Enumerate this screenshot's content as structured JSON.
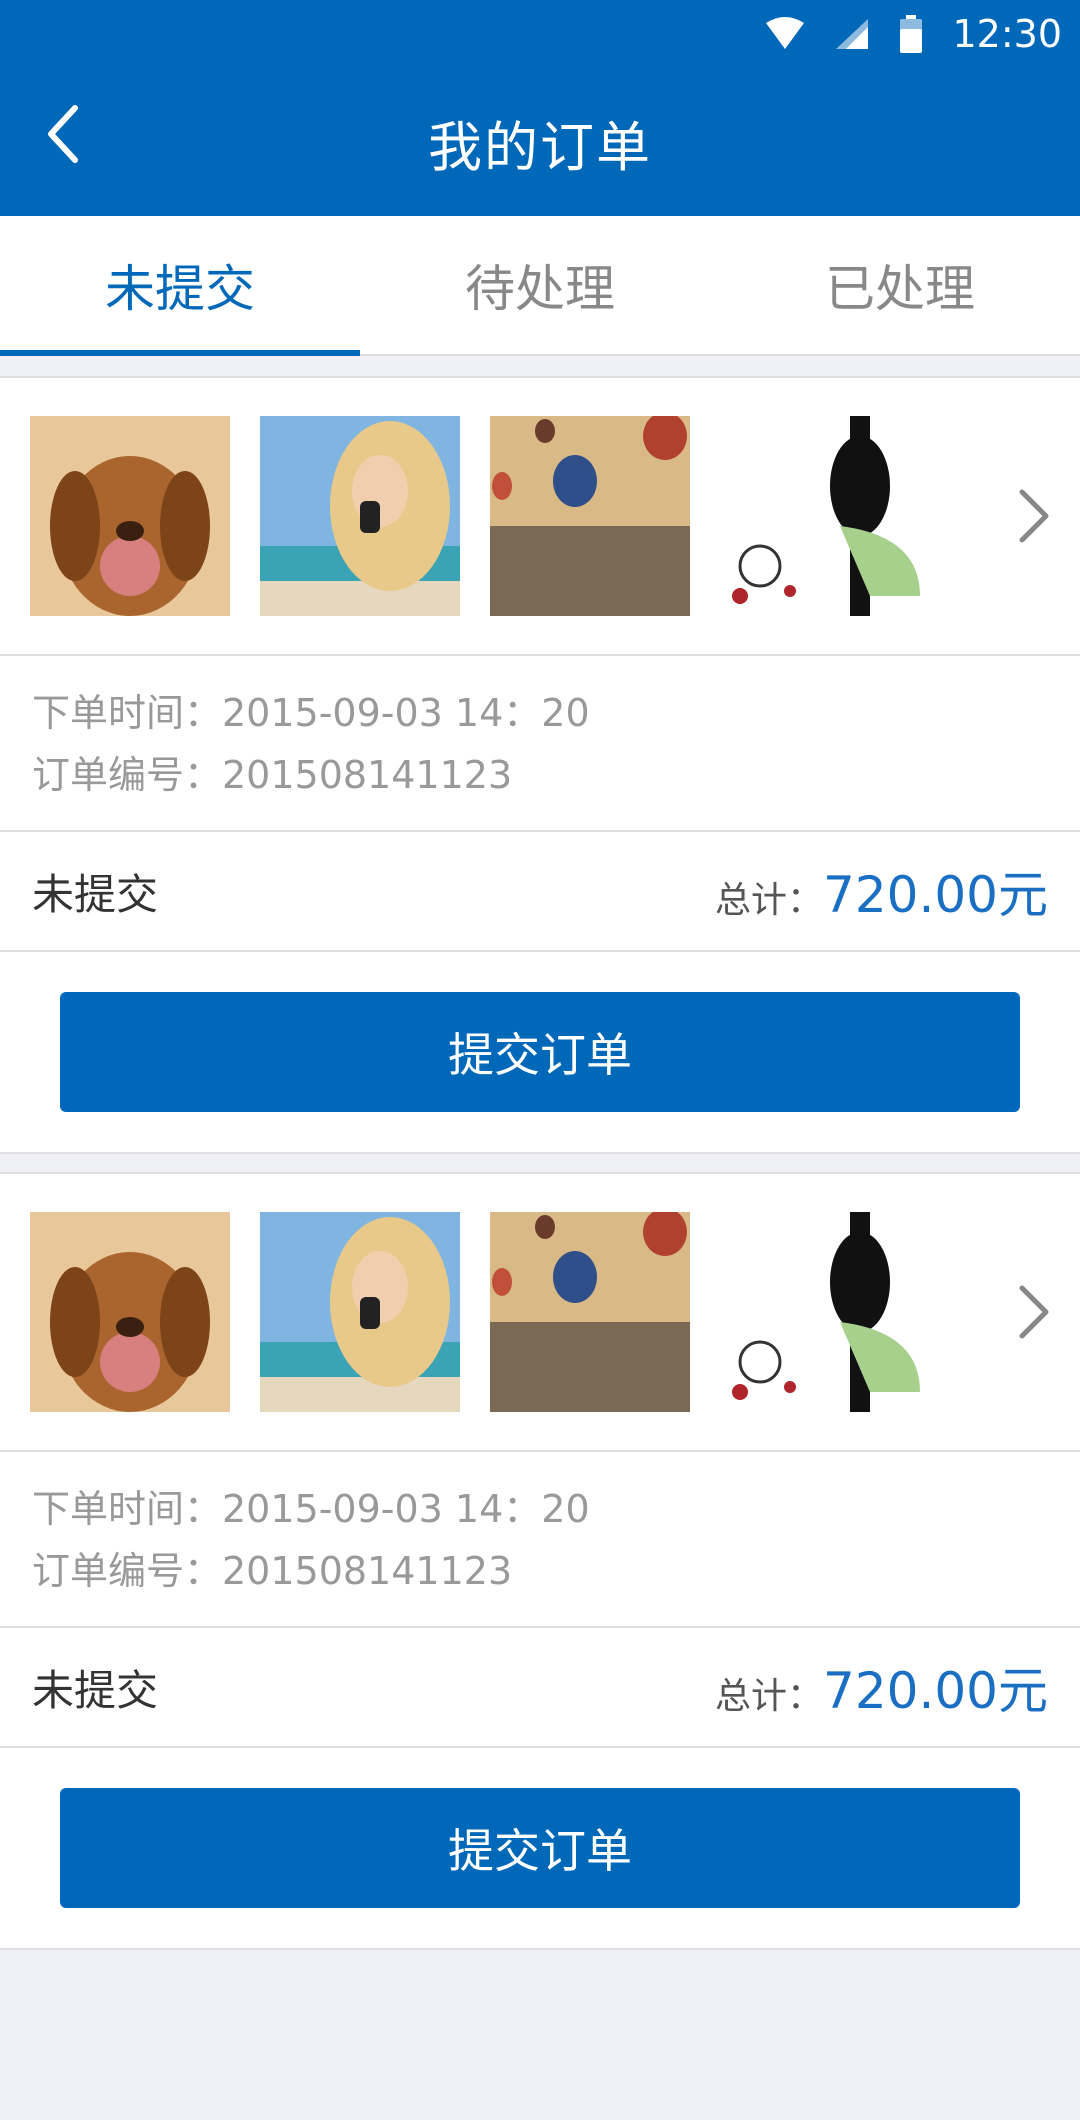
{
  "status_bar": {
    "time": "12:30",
    "icons": [
      "wifi-icon",
      "signal-icon",
      "battery-icon"
    ]
  },
  "header": {
    "title": "我的订单",
    "back_icon": "chevron-left-icon"
  },
  "tabs": [
    {
      "label": "未提交",
      "active": true
    },
    {
      "label": "待处理",
      "active": false
    },
    {
      "label": "已处理",
      "active": false
    }
  ],
  "orders": [
    {
      "thumbnails": [
        "puppy-photo",
        "woman-on-phone-photo",
        "hot-air-balloons-photo",
        "floral-silhouette-art"
      ],
      "order_time": "下单时间：2015-09-03   14：20",
      "order_number": "订单编号：201508141123",
      "status": "未提交",
      "total_label": "总计：",
      "total_amount": "720.00元",
      "button_label": "提交订单"
    },
    {
      "thumbnails": [
        "puppy-photo",
        "woman-on-phone-photo",
        "hot-air-balloons-photo",
        "floral-silhouette-art"
      ],
      "order_time": "下单时间：2015-09-03   14：20",
      "order_number": "订单编号：201508141123",
      "status": "未提交",
      "total_label": "总计：",
      "total_amount": "720.00元",
      "button_label": "提交订单"
    }
  ],
  "colors": {
    "primary": "#0068b8",
    "price": "#1a6fc2",
    "background": "#efeff6"
  }
}
